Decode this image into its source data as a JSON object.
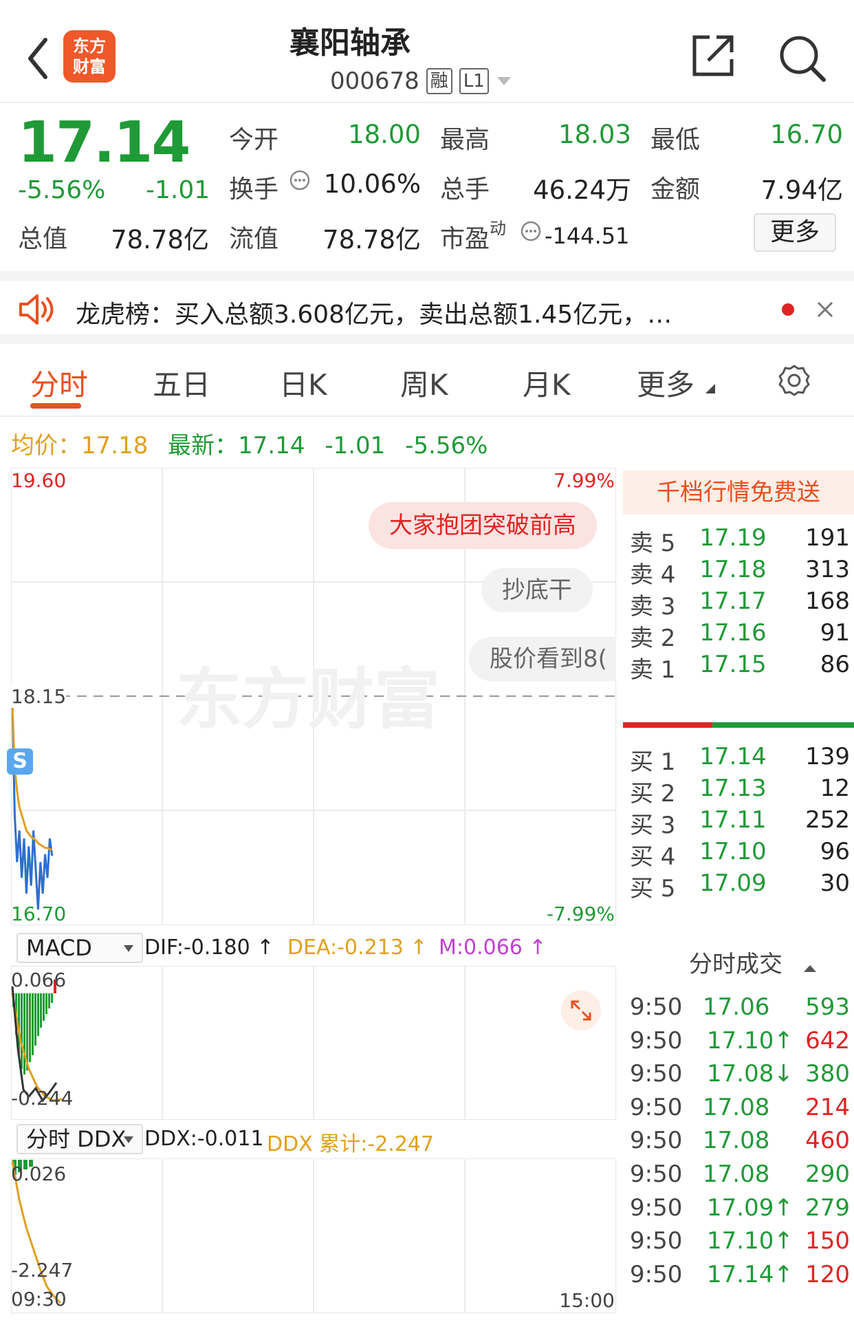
{
  "header": {
    "logo_line1": "东方",
    "logo_line2": "财富",
    "title": "襄阳轴承",
    "code": "000678",
    "tag_rong": "融",
    "tag_level": "L1"
  },
  "quote": {
    "price": "17.14",
    "change_pct": "-5.56%",
    "change": "-1.01",
    "open_label": "今开",
    "open": "18.00",
    "high_label": "最高",
    "high": "18.03",
    "low_label": "最低",
    "low": "16.70",
    "turnover_label": "换手",
    "turnover": "10.06%",
    "volume_label": "总手",
    "volume": "46.24万",
    "amount_label": "金额",
    "amount": "7.94亿",
    "mktcap_label": "总值",
    "mktcap": "78.78亿",
    "float_label": "流值",
    "float": "78.78亿",
    "pe_label": "市盈",
    "pe_sup": "动",
    "pe": "-144.51",
    "more_button": "更多"
  },
  "notice": {
    "text": "龙虎榜：买入总额3.608亿元，卖出总额1.45亿元，…"
  },
  "tabs": [
    "分时",
    "五日",
    "日K",
    "周K",
    "月K",
    "更多"
  ],
  "avg_row": {
    "avg_label": "均价：",
    "avg": "17.18",
    "latest_label": "最新：",
    "latest": "17.14",
    "change": "-1.01",
    "change_pct": "-5.56%"
  },
  "chart": {
    "top_price": "19.60",
    "top_pct": "7.99%",
    "mid_price": "18.15",
    "bottom_price": "16.70",
    "bottom_pct": "-7.99%",
    "watermark": "东方财富",
    "bubbles": [
      "大家抱团突破前高",
      "抄底干",
      "股价看到8("
    ],
    "s_marker": "S",
    "time_start": "09:30",
    "time_end": "15:00"
  },
  "chart_data": {
    "type": "line",
    "ylim": [
      16.7,
      19.6
    ],
    "series": [
      {
        "values": [
          18.1,
          17.4,
          17.1,
          17.3,
          17.0,
          17.25,
          16.9,
          17.2,
          16.95,
          17.3,
          17.05,
          16.8,
          17.1,
          16.9,
          17.15,
          17.0,
          17.25,
          17.14
        ]
      },
      {
        "values": [
          18.1,
          17.7,
          17.55,
          17.45,
          17.4,
          17.35,
          17.3,
          17.28,
          17.26,
          17.25,
          17.24,
          17.22,
          17.21,
          17.2,
          17.19,
          17.19,
          17.18,
          17.18
        ]
      }
    ]
  },
  "macd": {
    "selector": "MACD",
    "dif": "DIF:-0.180 ↑",
    "dea": "DEA:-0.213 ↑",
    "m": "M:0.066 ↑",
    "top": "0.066",
    "bottom": "-0.244"
  },
  "ddx": {
    "selector": "分时 DDX",
    "ddx": "DDX:-0.011",
    "ddx_sum": "DDX 累计:-2.247",
    "top": "0.026",
    "bottom": "-2.247"
  },
  "order_book": {
    "promo": "千档行情免费送",
    "asks": [
      {
        "label": "卖 5",
        "price": "17.19",
        "vol": "191"
      },
      {
        "label": "卖 4",
        "price": "17.18",
        "vol": "313"
      },
      {
        "label": "卖 3",
        "price": "17.17",
        "vol": "168"
      },
      {
        "label": "卖 2",
        "price": "17.16",
        "vol": "91"
      },
      {
        "label": "卖 1",
        "price": "17.15",
        "vol": "86"
      }
    ],
    "bids": [
      {
        "label": "买 1",
        "price": "17.14",
        "vol": "139"
      },
      {
        "label": "买 2",
        "price": "17.13",
        "vol": "12"
      },
      {
        "label": "买 3",
        "price": "17.11",
        "vol": "252"
      },
      {
        "label": "买 4",
        "price": "17.10",
        "vol": "96"
      },
      {
        "label": "买 5",
        "price": "17.09",
        "vol": "30"
      }
    ]
  },
  "trades": {
    "title": "分时成交",
    "rows": [
      {
        "time": "9:50",
        "price": "17.06",
        "vol": "593"
      },
      {
        "time": "9:50",
        "price": "17.10↑",
        "vol": "642"
      },
      {
        "time": "9:50",
        "price": "17.08↓",
        "vol": "380"
      },
      {
        "time": "9:50",
        "price": "17.08",
        "vol": "214"
      },
      {
        "time": "9:50",
        "price": "17.08",
        "vol": "460"
      },
      {
        "time": "9:50",
        "price": "17.08",
        "vol": "290"
      },
      {
        "time": "9:50",
        "price": "17.09↑",
        "vol": "279"
      },
      {
        "time": "9:50",
        "price": "17.10↑",
        "vol": "150"
      },
      {
        "time": "9:50",
        "price": "17.14↑",
        "vol": "120"
      }
    ],
    "vol_colors": [
      "#1f9a37",
      "#e02424",
      "#1f9a37",
      "#e02424",
      "#e02424",
      "#1f9a37",
      "#1f9a37",
      "#e02424",
      "#e02424"
    ]
  },
  "colors": {
    "down": "#1f9a37",
    "up": "#e02424",
    "accent": "#e8501f",
    "price_line": "#2f6fcf",
    "avg_line": "#e0a020"
  }
}
